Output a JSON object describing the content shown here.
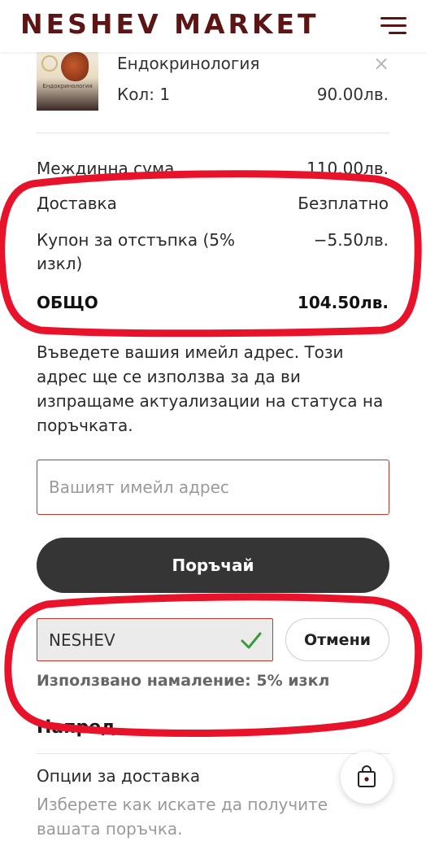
{
  "header": {
    "brand": "NESHEV MARKET",
    "menu_icon": "hamburger-menu-icon"
  },
  "cart_item": {
    "title": "Ендокринология",
    "thumb_text": "Ендокринология",
    "qty": "Кол: 1",
    "price": "90.00лв.",
    "remove_symbol": "×"
  },
  "summary": {
    "subtotal_label": "Междинна сума",
    "subtotal_value": "110.00лв.",
    "shipping_label": "Доставка",
    "shipping_value": "Безплатно",
    "coupon_label_line1": "Купон за отстъпка (5%",
    "coupon_label_line2": "изкл)",
    "coupon_value": "−5.50лв.",
    "total_label": "ОБЩО",
    "total_value": "104.50лв."
  },
  "info_text": "Въведете вашия имейл адрес. Този адрес ще се използва за да ви изпращаме актуализации на статуса на поръчката.",
  "email": {
    "placeholder": "Вашият имейл адрес",
    "value": ""
  },
  "order_button": "Поръчай",
  "coupon": {
    "code": "NESHEV",
    "cancel_label": "Отмени",
    "applied_note": "Използвано намаление: 5% изкл"
  },
  "next_section": {
    "title": "Напред",
    "option_title": "Опции за доставка",
    "option_subtitle": "Изберете как искате да получите вашата поръчка."
  },
  "colors": {
    "brand": "#5c1414",
    "annotation": "#e8132b",
    "button_dark": "#353535",
    "check": "#3a9a3a"
  }
}
